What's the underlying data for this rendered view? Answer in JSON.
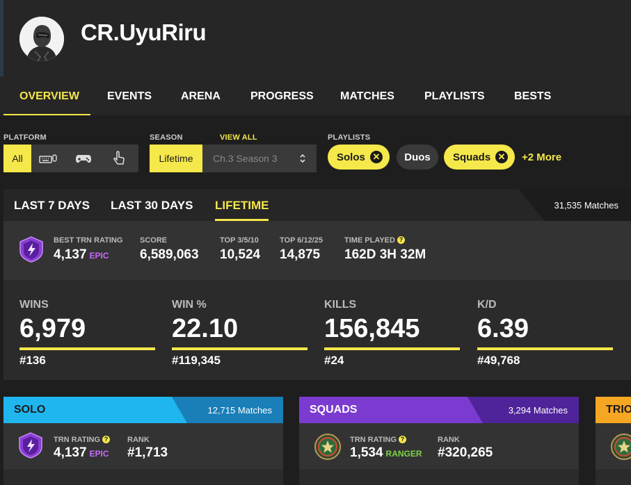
{
  "profile": {
    "username": "CR.UyuRiru"
  },
  "nav": [
    "Overview",
    "Events",
    "Arena",
    "Progress",
    "Matches",
    "Playlists",
    "Bests"
  ],
  "filters": {
    "platform_label": "PLATFORM",
    "platform_all": "All",
    "season_label": "SEASON",
    "view_all": "VIEW ALL",
    "season_selected": "Lifetime",
    "season_dropdown": "Ch.3 Season 3",
    "playlists_label": "PLAYLISTS",
    "playlists": [
      "Solos",
      "Duos",
      "Squads"
    ],
    "more": "+2 More"
  },
  "overview": {
    "tabs": [
      "Last 7 Days",
      "Last 30 Days",
      "Lifetime"
    ],
    "matches": "31,535 Matches",
    "best_trn_label": "BEST TRN RATING",
    "best_trn_value": "4,137",
    "best_trn_tier": "EPIC",
    "score_label": "SCORE",
    "score_value": "6,589,063",
    "top3_label": "TOP 3/5/10",
    "top3_value": "10,524",
    "top6_label": "TOP 6/12/25",
    "top6_value": "14,875",
    "time_label": "TIME PLAYED",
    "time_value": "162D 3H 32M",
    "big_stats": [
      {
        "label": "WINS",
        "value": "6,979",
        "rank": "#136"
      },
      {
        "label": "WIN %",
        "value": "22.10",
        "rank": "#119,345"
      },
      {
        "label": "KILLS",
        "value": "156,845",
        "rank": "#24"
      },
      {
        "label": "K/D",
        "value": "6.39",
        "rank": "#49,768"
      }
    ]
  },
  "cards": {
    "solo": {
      "title": "SOLO",
      "matches": "12,715 Matches",
      "trn_label": "TRN RATING",
      "trn_value": "4,137",
      "tier": "EPIC",
      "rank_label": "RANK",
      "rank_value": "#1,713"
    },
    "squads": {
      "title": "SQUADS",
      "matches": "3,294 Matches",
      "trn_label": "TRN RATING",
      "trn_value": "1,534",
      "tier": "RANGER",
      "rank_label": "RANK",
      "rank_value": "#320,265"
    },
    "trios": {
      "title": "TRIOS"
    }
  },
  "colors": {
    "accent": "#f5e84a",
    "solo": "#1fb6ef",
    "squads": "#7b3bd0",
    "trios": "#f5a623",
    "epic": "#c96bff",
    "ranger": "#7ed348"
  }
}
